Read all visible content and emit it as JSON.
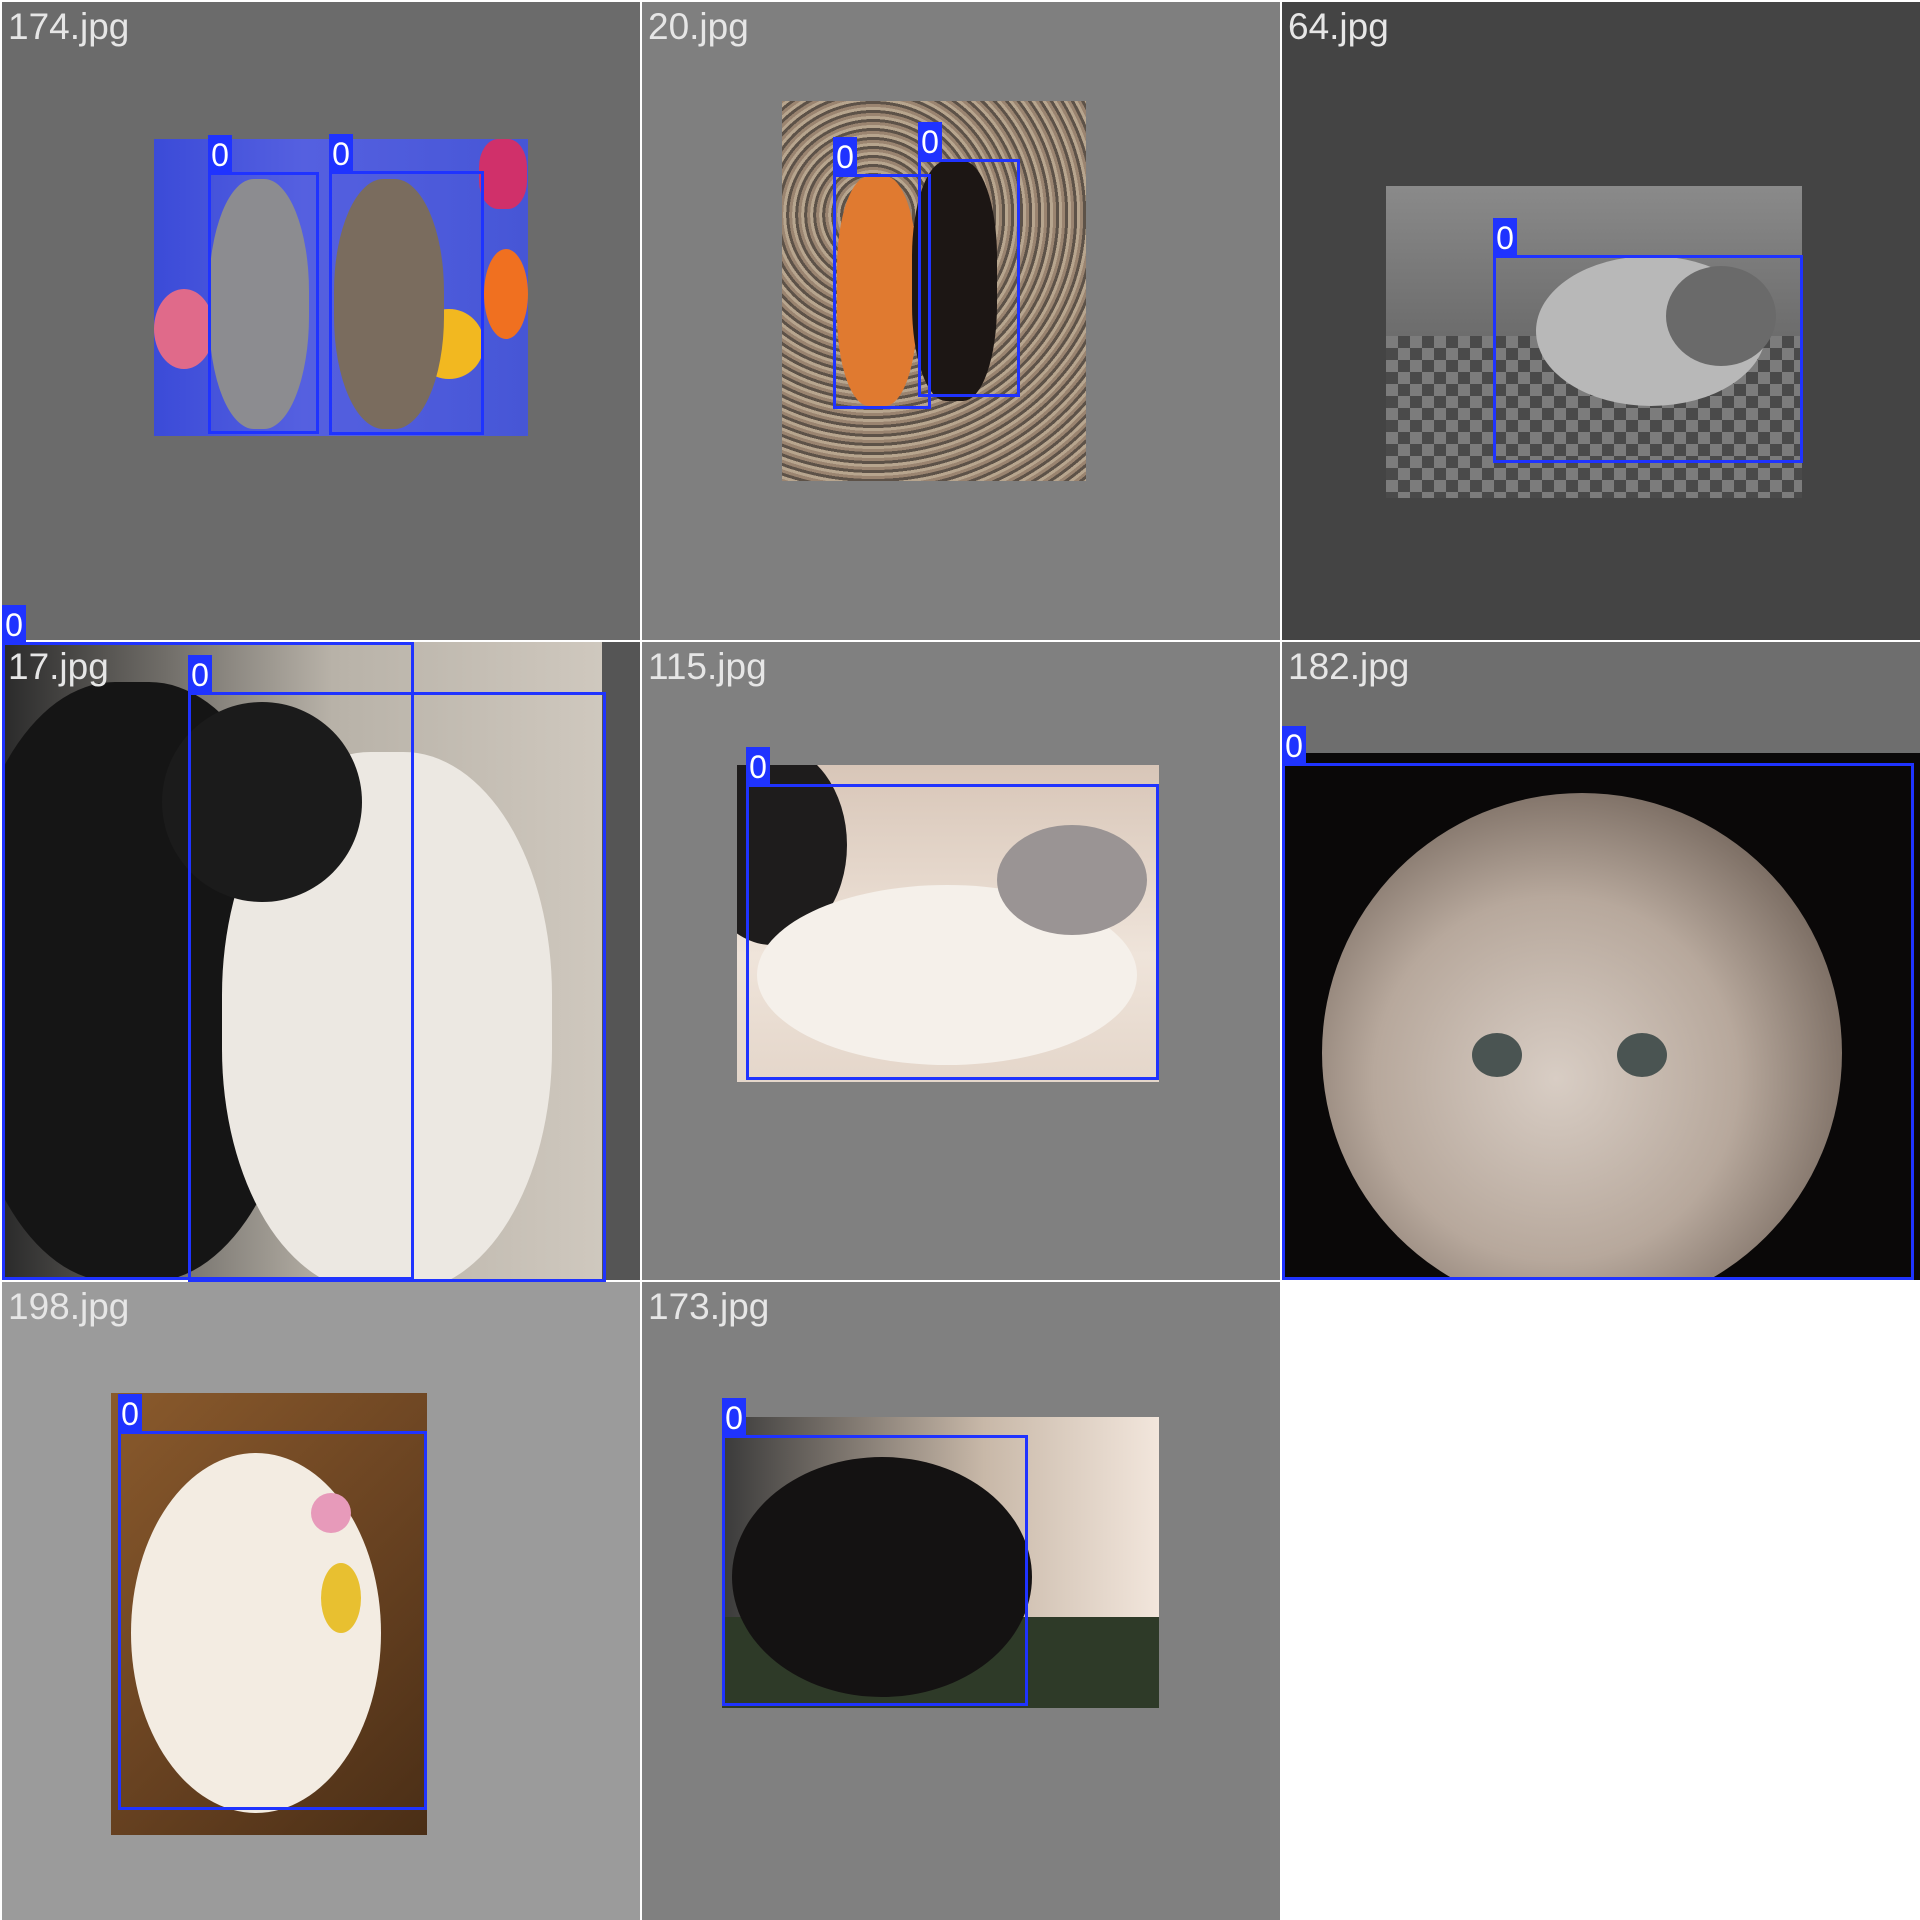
{
  "tiles": [
    {
      "file": "174.jpg",
      "photo": "two tabby kittens with collars among flowers",
      "boxes": [
        {
          "label": "0"
        },
        {
          "label": "0"
        }
      ]
    },
    {
      "file": "20.jpg",
      "photo": "two cats lying on gravel",
      "boxes": [
        {
          "label": "0"
        },
        {
          "label": "0"
        }
      ]
    },
    {
      "file": "64.jpg",
      "photo": "grey and white cat lying on checkered blanket",
      "boxes": [
        {
          "label": "0"
        }
      ]
    },
    {
      "file": "17.jpg",
      "photo": "black cat and white cat cuddling",
      "boxes": [
        {
          "label": "0"
        },
        {
          "label": "0"
        }
      ]
    },
    {
      "file": "115.jpg",
      "photo": "white cat stretching on a person",
      "boxes": [
        {
          "label": "0"
        }
      ]
    },
    {
      "file": "182.jpg",
      "photo": "fluffy kitten close-up",
      "boxes": [
        {
          "label": "0"
        }
      ]
    },
    {
      "file": "198.jpg",
      "photo": "white kitten playing with a toy on wooden floor",
      "boxes": [
        {
          "label": "0"
        }
      ]
    },
    {
      "file": "173.jpg",
      "photo": "black cat lying in grass",
      "boxes": [
        {
          "label": "0"
        }
      ]
    }
  ],
  "colors": {
    "box": "#1f33ff",
    "box_label_text": "#ffffff",
    "tile_label_text": "#e6e6e6"
  }
}
